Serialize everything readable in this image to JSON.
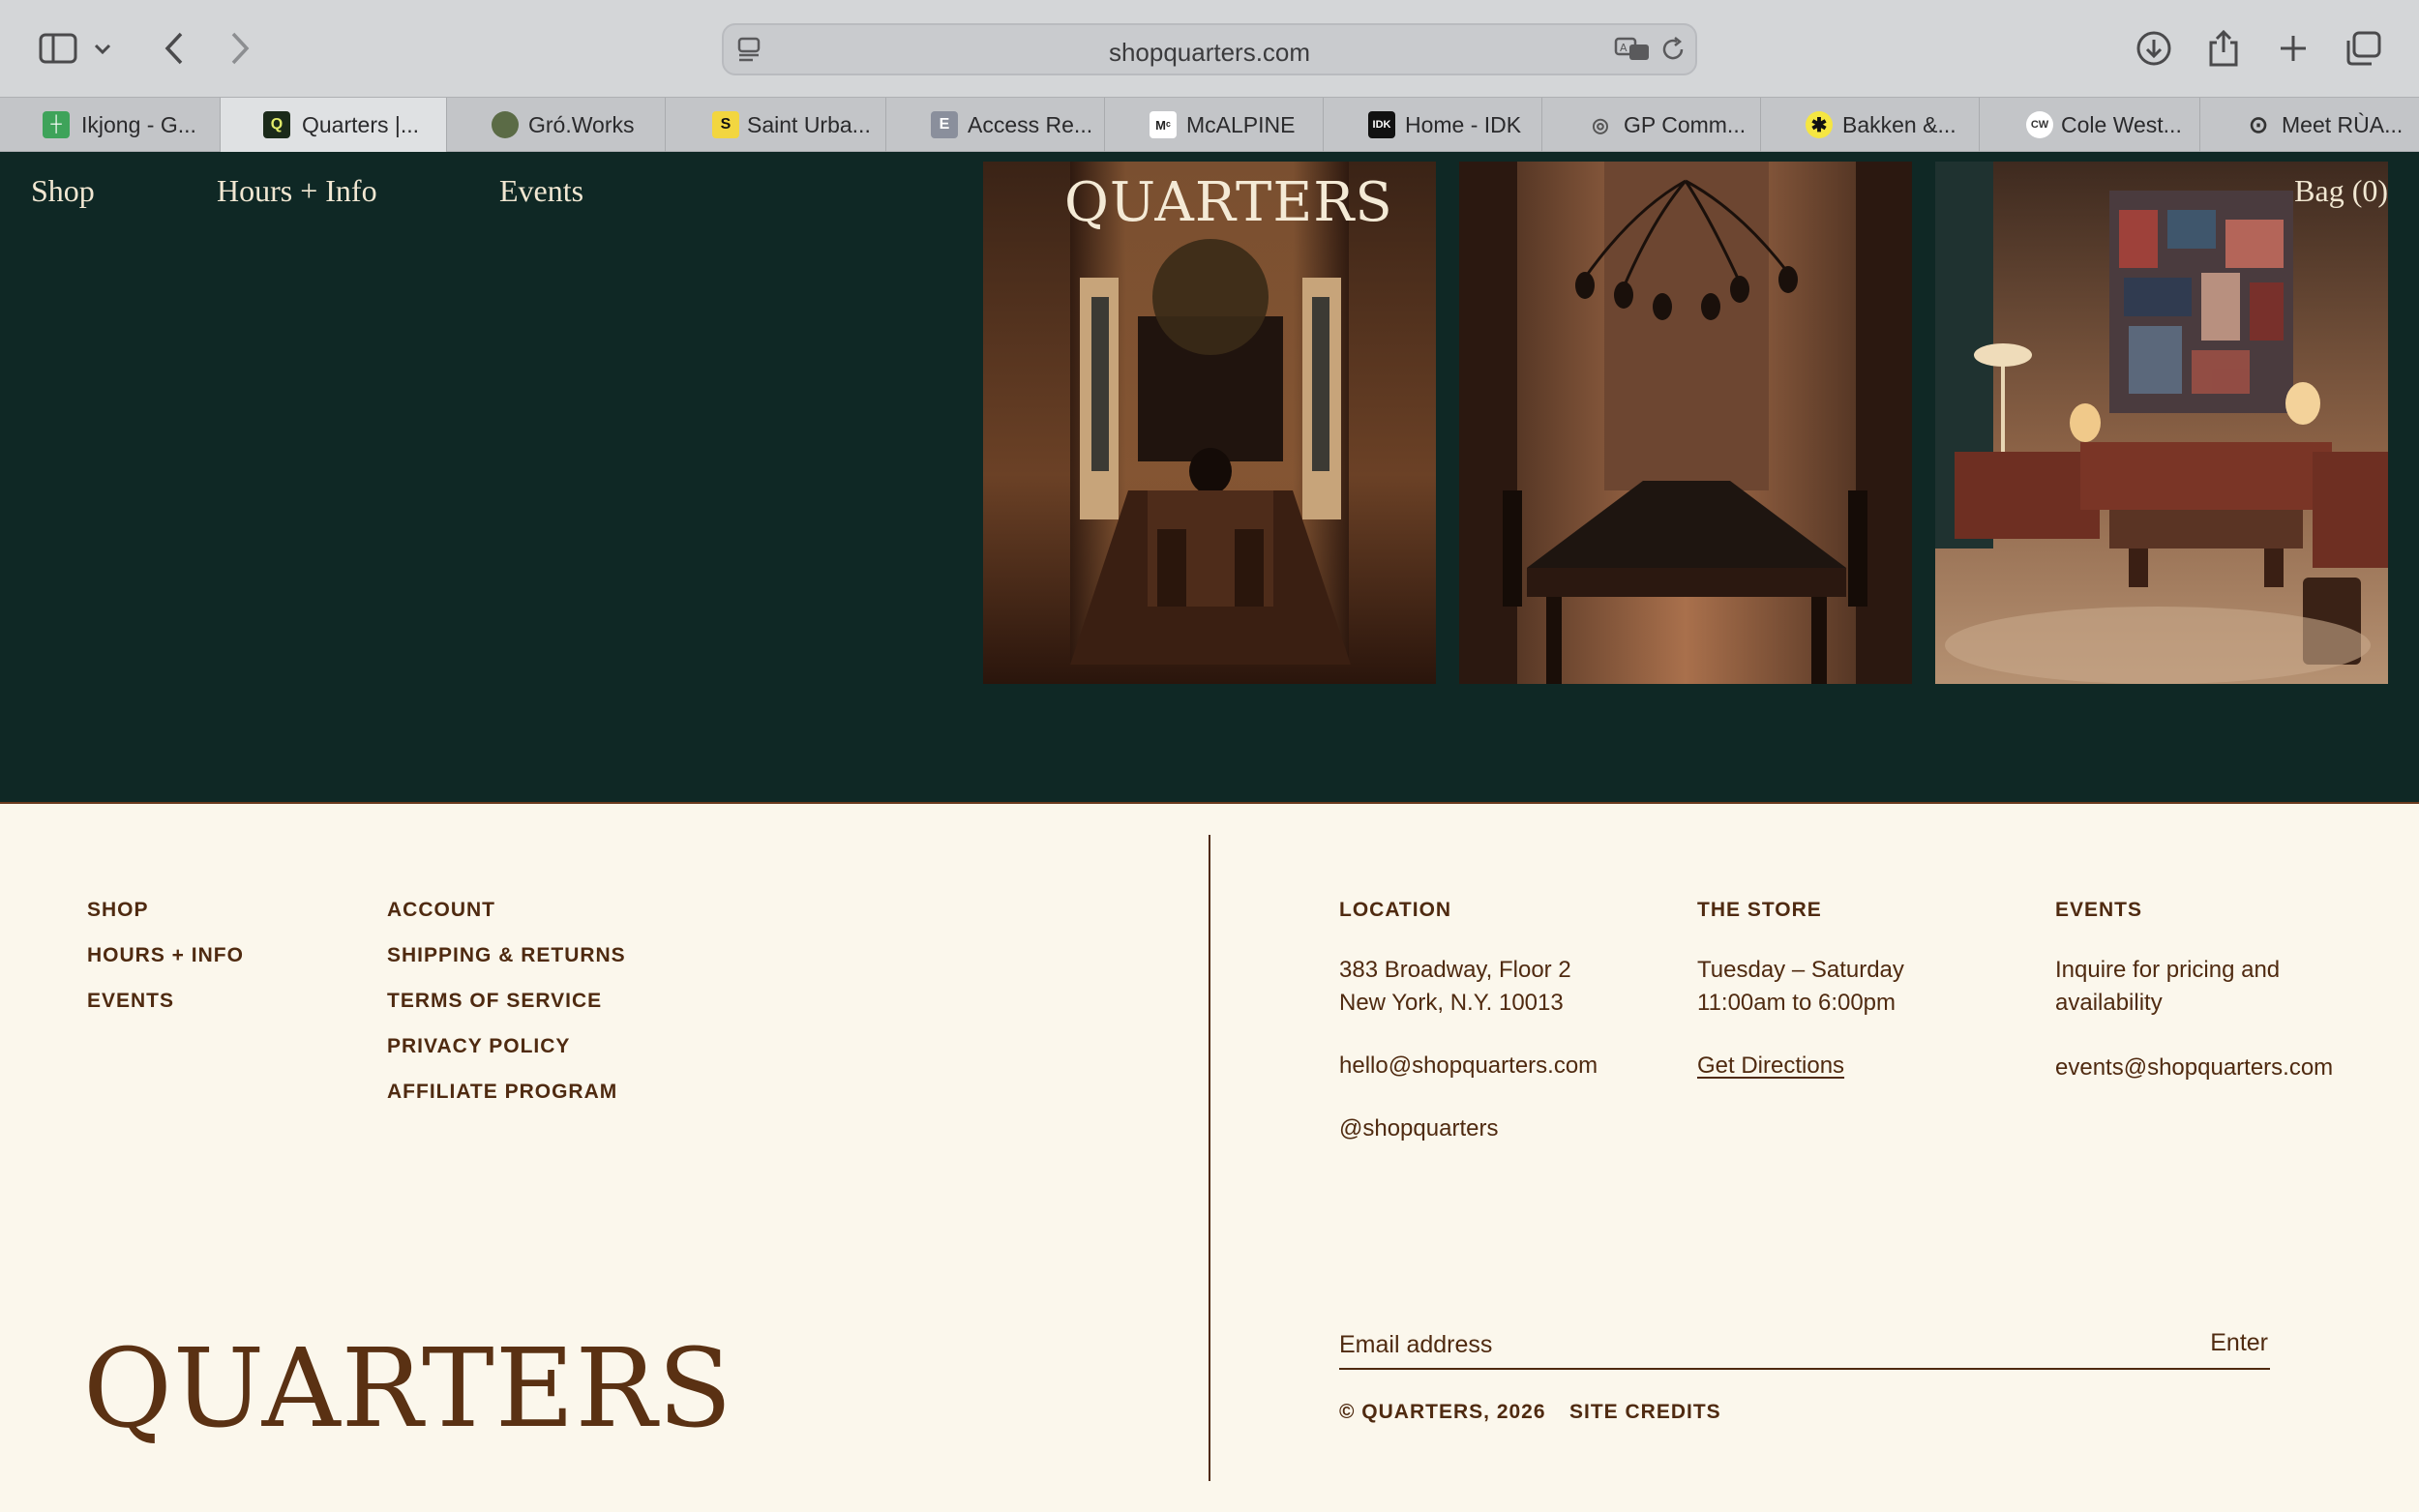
{
  "browser": {
    "url": "shopquarters.com",
    "tabs": [
      {
        "label": "Ikjong - G...",
        "fav_color": "#3ea35a",
        "fav_char": "┼"
      },
      {
        "label": "Quarters |...",
        "fav_color": "#1b2a1a",
        "fav_char": "Q"
      },
      {
        "label": "Gró.Works",
        "fav_color": "#5b6b46",
        "fav_char": ""
      },
      {
        "label": "Saint Urba...",
        "fav_color": "#f2d640",
        "fav_char": "S"
      },
      {
        "label": "Access Re...",
        "fav_color": "#8a8f9c",
        "fav_char": "E"
      },
      {
        "label": "McALPINE",
        "fav_color": "#ffffff",
        "fav_char": "Mᶜ"
      },
      {
        "label": "Home - IDK",
        "fav_color": "#111111",
        "fav_char": "IDK"
      },
      {
        "label": "GP Comm...",
        "fav_color": "#c3c5c8",
        "fav_char": "◎"
      },
      {
        "label": "Bakken &...",
        "fav_color": "#f5e642",
        "fav_char": "✱"
      },
      {
        "label": "Cole West...",
        "fav_color": "#ffffff",
        "fav_char": "CW"
      },
      {
        "label": "Meet RÙA...",
        "fav_color": "#c3c5c8",
        "fav_char": "⊙"
      }
    ]
  },
  "header": {
    "nav": [
      "Shop",
      "Hours + Info",
      "Events"
    ],
    "logo": "QUARTERS",
    "bag": "Bag (0)"
  },
  "footer": {
    "col1": [
      "SHOP",
      "HOURS + INFO",
      "EVENTS"
    ],
    "col2": [
      "ACCOUNT",
      "SHIPPING & RETURNS",
      "TERMS OF SERVICE",
      "PRIVACY POLICY",
      "AFFILIATE PROGRAM"
    ],
    "location": {
      "heading": "LOCATION",
      "address1": "383 Broadway, Floor 2",
      "address2": "New York, N.Y. 10013",
      "email": "hello@shopquarters.com",
      "social": "@shopquarters"
    },
    "store": {
      "heading": "THE STORE",
      "days": "Tuesday – Saturday",
      "hours": "11:00am to 6:00pm",
      "directions": "Get Directions"
    },
    "events": {
      "heading": "EVENTS",
      "text1": "Inquire for pricing and",
      "text2": "availability",
      "email": "events@shopquarters.com"
    },
    "logo": "QUARTERS",
    "email_placeholder": "Email address",
    "enter": "Enter",
    "copyright": "© QUARTERS, 2026",
    "credits": "SITE CREDITS"
  }
}
